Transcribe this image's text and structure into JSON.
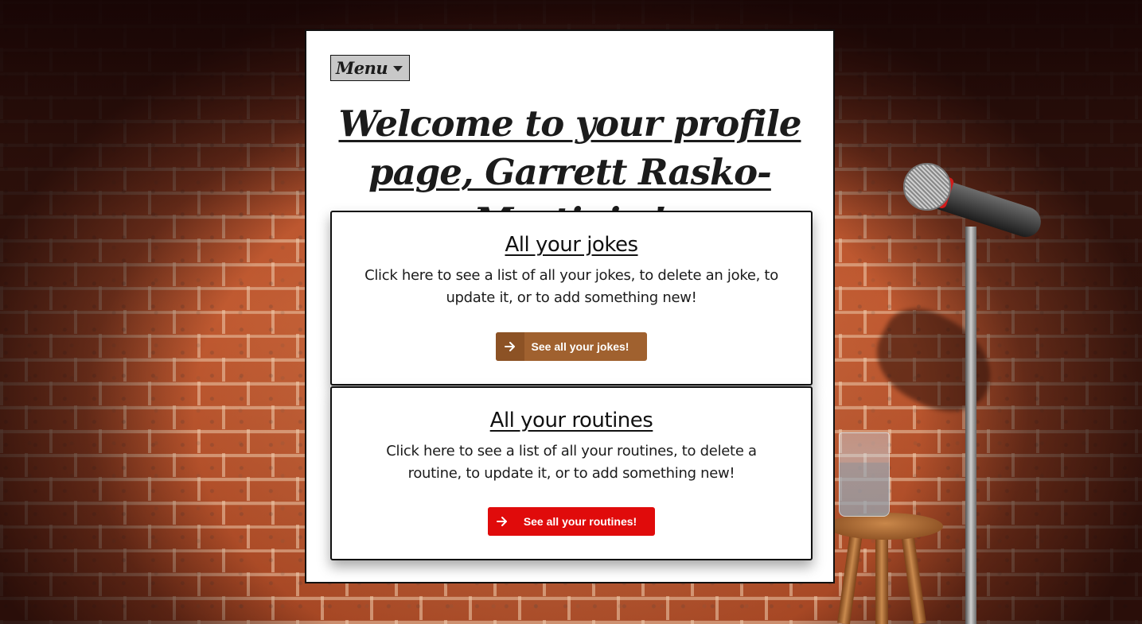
{
  "menu": {
    "label": "Menu"
  },
  "header": {
    "title": "Welcome to your profile page, Garrett Rasko-Martinis !"
  },
  "cards": [
    {
      "title": "All your jokes",
      "description": "Click here to see a list of all your jokes, to delete an joke, to update it, or to add something new!",
      "button_label": "See all your jokes!",
      "button_icon": "arrow-right-icon",
      "accent": "#a0612f"
    },
    {
      "title": "All your routines",
      "description": "Click here to see a list of all your routines, to delete a routine, to update it, or to add something new!",
      "button_label": "See all your routines!",
      "button_icon": "arrow-right-icon",
      "accent": "#e00b0b"
    }
  ],
  "colors": {
    "panel": "#ffffff",
    "menu_bg": "#c8c8c8",
    "text": "#1b1b1b"
  }
}
